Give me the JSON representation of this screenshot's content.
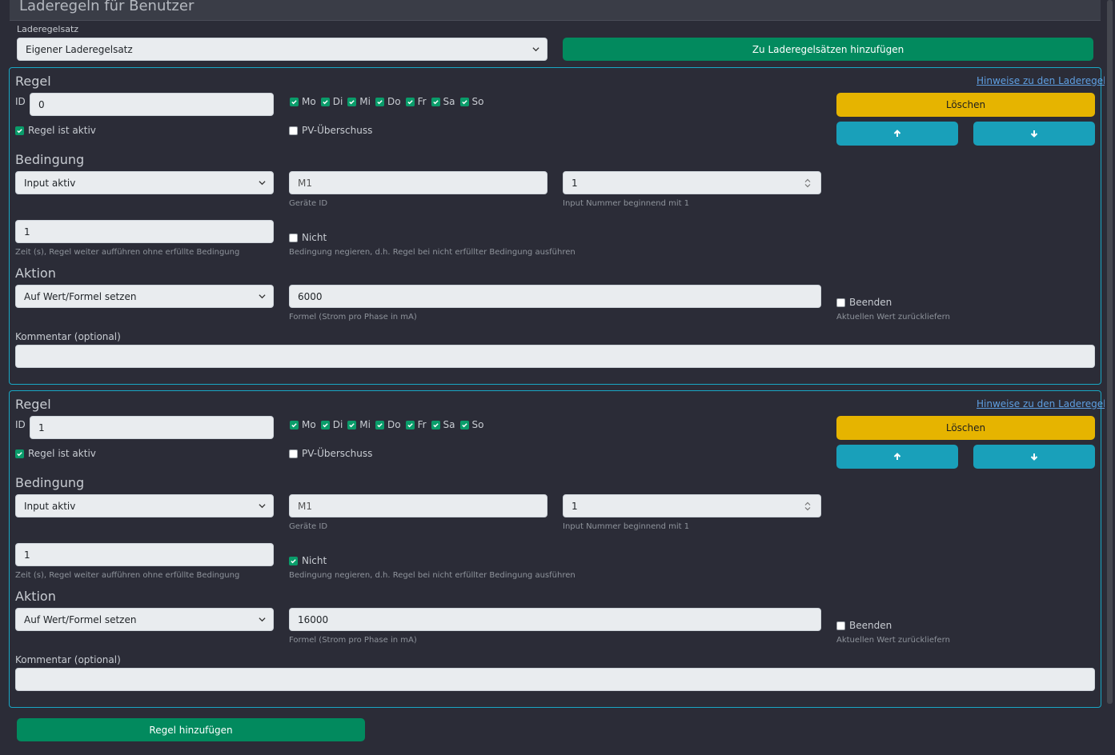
{
  "header": {
    "title": "Laderegeln für Benutzer"
  },
  "ruleset": {
    "label": "Laderegelsatz",
    "selected": "Eigener Laderegelsatz",
    "add_button": "Zu Laderegelsätzen hinzufügen"
  },
  "rules": [
    {
      "title": "Regel",
      "hint_link": "Hinweise zu den Laderegeln",
      "id_label": "ID",
      "id_value": "0",
      "days": [
        "Mo",
        "Di",
        "Mi",
        "Do",
        "Fr",
        "Sa",
        "So"
      ],
      "active_label": "Regel ist aktiv",
      "pv_label": "PV-Überschuss",
      "delete_label": "Löschen",
      "condition_title": "Bedingung",
      "condition_type": "Input aktiv",
      "device_id": "M1",
      "device_id_help": "Geräte ID",
      "input_number": "1",
      "input_number_help": "Input Nummer beginnend mit 1",
      "time_value": "1",
      "time_help": "Zeit (s), Regel weiter aufführen ohne erfüllte Bedingung",
      "negate_label": "Nicht",
      "negate_help": "Bedingung negieren, d.h. Regel bei nicht erfüllter Bedingung ausführen",
      "action_title": "Aktion",
      "action_type": "Auf Wert/Formel setzen",
      "formula_value": "6000",
      "formula_help": "Formel (Strom pro Phase in mA)",
      "end_label": "Beenden",
      "end_help": "Aktuellen Wert zurückliefern",
      "comment_label": "Kommentar (optional)",
      "comment_value": ""
    },
    {
      "title": "Regel",
      "hint_link": "Hinweise zu den Laderegeln",
      "id_label": "ID",
      "id_value": "1",
      "days": [
        "Mo",
        "Di",
        "Mi",
        "Do",
        "Fr",
        "Sa",
        "So"
      ],
      "active_label": "Regel ist aktiv",
      "pv_label": "PV-Überschuss",
      "delete_label": "Löschen",
      "condition_title": "Bedingung",
      "condition_type": "Input aktiv",
      "device_id": "M1",
      "device_id_help": "Geräte ID",
      "input_number": "1",
      "input_number_help": "Input Nummer beginnend mit 1",
      "time_value": "1",
      "time_help": "Zeit (s), Regel weiter aufführen ohne erfüllte Bedingung",
      "negate_label": "Nicht",
      "negate_help": "Bedingung negieren, d.h. Regel bei nicht erfüllter Bedingung ausführen",
      "action_title": "Aktion",
      "action_type": "Auf Wert/Formel setzen",
      "formula_value": "16000",
      "formula_help": "Formel (Strom pro Phase in mA)",
      "end_label": "Beenden",
      "end_help": "Aktuellen Wert zurückliefern",
      "comment_label": "Kommentar (optional)",
      "comment_value": ""
    }
  ],
  "add_rule_button": "Regel hinzufügen",
  "colors": {
    "background": "#2b2c37",
    "primary_green": "#028a5e",
    "warning_yellow": "#e6b400",
    "info_teal": "#19a0ba",
    "panel_border": "#19a7c4",
    "link_blue": "#5e9ee0"
  }
}
